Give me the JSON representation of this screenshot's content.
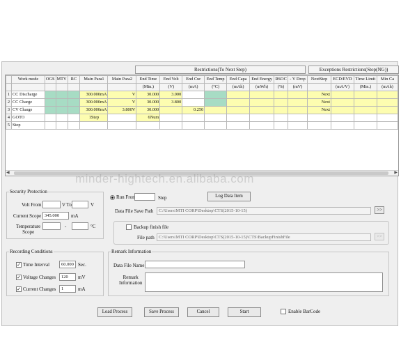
{
  "group_headers": {
    "restrictions": "Restrictions(To Next Step)",
    "exceptions": "Exceptions Restrictions(Stop(NG))"
  },
  "grid": {
    "columns": [
      "",
      "Work mode",
      "OGS",
      "MTV",
      "RC",
      "Main Para1",
      "Main Para2",
      "End Time",
      "End Volt",
      "End Cur",
      "End Temp",
      "End Capa",
      "End Energy",
      "RSOC",
      "- V Drop",
      "NextStep",
      "ECD/EVD",
      "Time Limit",
      "Min Ca"
    ],
    "units": [
      "",
      "",
      "",
      "",
      "",
      "",
      "",
      "(Min.)",
      "(V)",
      "(mA)",
      "(°C)",
      "(mAh)",
      "(mWh)",
      "(%)",
      "(mV)",
      "",
      "(mA/V)",
      "(Min.)",
      "(mAh)"
    ],
    "rows": [
      {
        "num": "1",
        "mode": "CC Discharge",
        "p1": "300.000mA",
        "p2": "V",
        "time": "30.000",
        "volt": "3.000",
        "cur": "",
        "next": "Next"
      },
      {
        "num": "2",
        "mode": "CC Charge",
        "p1": "300.000mA",
        "p2": "V",
        "time": "30.000",
        "volt": "3.800",
        "cur": "",
        "next": "Next"
      },
      {
        "num": "3",
        "mode": "CV Charge",
        "p1": "300.000mA",
        "p2": "3.800V",
        "time": "30.000",
        "volt": "",
        "cur": "0.250",
        "next": "Next"
      },
      {
        "num": "4",
        "mode": "GOTO",
        "p1": "1Step",
        "p2": "",
        "time": "6Num",
        "volt": "",
        "cur": "",
        "next": ""
      },
      {
        "num": "5",
        "mode": "Stop",
        "p1": "",
        "p2": "",
        "time": "",
        "volt": "",
        "cur": "",
        "next": ""
      }
    ]
  },
  "watermark": "minder-hightech.en.alibaba.com",
  "security": {
    "title": "Security Protection",
    "volt_from_label": "Volt From",
    "volt_from_value": "",
    "v_to_label": "V To",
    "volt_to_value": "",
    "v_unit": "V",
    "current_scope_label": "Current Scope",
    "current_scope_value": "345.000",
    "ma_unit": "mA",
    "temperature_label": "Temperature\nScope",
    "temp_from_value": "",
    "dash": "-",
    "celsius_unit": "°C"
  },
  "run": {
    "run_from_label": "Run From",
    "run_from_value": "",
    "step_label": "Step",
    "log_button": "Log Data Item",
    "save_path_label": "Data File Save Path",
    "save_path_value": "C:\\Users\\MTI CORP\\Desktop\\CTS(2015-10-15)",
    "browse_label": ">>",
    "backup_label": "Backup finish file",
    "file_path_label": "File path",
    "file_path_value": "C:\\Users\\MTI CORP\\Desktop\\CTS(2015-10-15)\\CTS\\BackupFinishFile",
    "browse2_label": ">>"
  },
  "recording": {
    "title": "Recording Conditions",
    "time_interval_label": "Time Interval",
    "time_interval_value": "60.000",
    "sec_unit": "Sec.",
    "voltage_changes_label": "Voltage Changes",
    "voltage_changes_value": "120",
    "mv_unit": "mV",
    "current_changes_label": "Current Changes",
    "current_changes_value": "1",
    "ma_unit": "mA"
  },
  "remark": {
    "title": "Remark Information",
    "data_file_name_label": "Data File Name",
    "data_file_name_value": "",
    "remark_label": "Remark\nInformation",
    "remark_value": ""
  },
  "buttons": {
    "load": "Load Process",
    "save": "Save Process",
    "cancel": "Cancel",
    "start": "Start",
    "enable_barcode": "Enable BarCode"
  }
}
